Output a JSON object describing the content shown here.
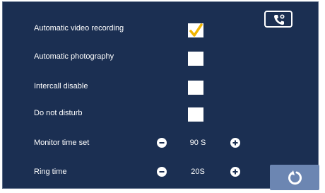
{
  "settings": {
    "auto_video_label": "Automatic video recording",
    "auto_photo_label": "Automatic photography",
    "intercall_label": "Intercall disable",
    "dnd_label": "Do not disturb",
    "monitor_label": "Monitor time set",
    "monitor_value": "90 S",
    "ring_label": "Ring time",
    "ring_value": "20S"
  },
  "checkboxes": {
    "auto_video": true,
    "auto_photo": false,
    "intercall": false,
    "dnd": false
  },
  "icons": {
    "top_right": "phone-call-icon",
    "back": "back-arrow-icon",
    "minus": "minus-circle-icon",
    "plus": "plus-circle-icon",
    "check": "check-icon"
  },
  "colors": {
    "background": "#1b2f52",
    "check_mark": "#f0b400",
    "back_button": "#6c86b2"
  }
}
